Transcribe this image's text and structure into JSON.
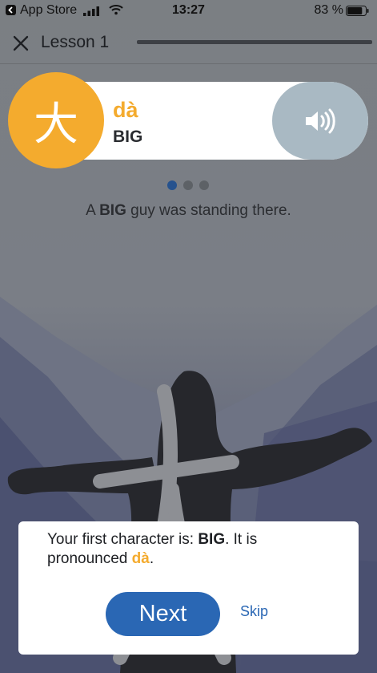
{
  "status_bar": {
    "back_app": "App Store",
    "time": "13:27",
    "battery_percent": "83 %",
    "battery_level": 0.83
  },
  "header": {
    "title": "Lesson 1",
    "close_icon": "close-icon"
  },
  "character": {
    "hanzi": "大",
    "pinyin": "dà",
    "meaning": "BIG",
    "audio_icon": "speaker-icon"
  },
  "pager": {
    "count": 3,
    "active_index": 0
  },
  "mnemonic": {
    "before": "A ",
    "highlight": "BIG",
    "after": " guy was standing there."
  },
  "dialog": {
    "line_prefix": "Your first character is: ",
    "english": "BIG",
    "line_middle": ". It is pronounced ",
    "pinyin": "dà",
    "line_suffix": ".",
    "next_label": "Next",
    "skip_label": "Skip"
  },
  "colors": {
    "accent_orange": "#f4ab2e",
    "primary_blue": "#2a67b4",
    "pager_active": "#26528e",
    "audio_button": "#a9b9c3"
  }
}
